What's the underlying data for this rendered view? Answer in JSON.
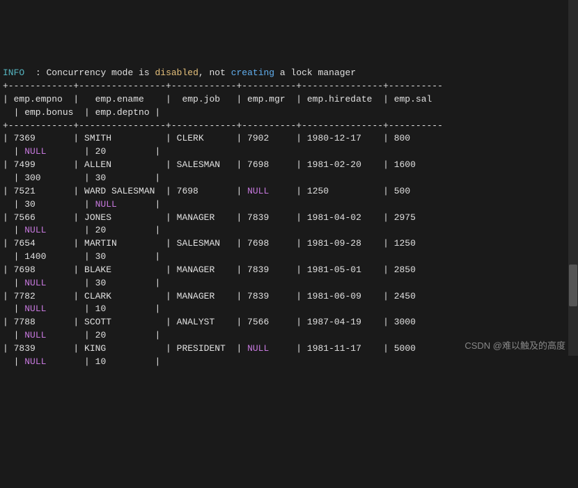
{
  "info_label": "INFO",
  "info_sep": "  : ",
  "info_msg_a": "Concurrency mode is ",
  "info_msg_b": "disabled",
  "info_msg_c": ", not ",
  "info_msg_d": "creating",
  "info_msg_e": " a lock manager",
  "divider_top": "+------------+----------------+------------+----------+---------------+----------",
  "header_line1": "| emp.empno  |   emp.ename    |  emp.job   | emp.mgr  | emp.hiredate  | emp.sal  ",
  "header_line2": "  | emp.bonus  | emp.deptno |",
  "divider_mid": "+------------+----------------+------------+----------+---------------+----------",
  "rows": [
    {
      "a": "| 7369       | SMITH          | CLERK      | 7902     | 1980-12-17    | 800      ",
      "b_pre": "  | ",
      "b_null": "NULL",
      "b_post": "       | 20         |"
    },
    {
      "a": "| 7499       | ALLEN          | SALESMAN   | 7698     | 1981-02-20    | 1600     ",
      "b_pre": "  | 300        | 30         |",
      "b_null": "",
      "b_post": ""
    },
    {
      "a_pre": "| 7521       | WARD SALESMAN  | 7698       | ",
      "a_null": "NULL",
      "a_post": "     | 1250          | 500      ",
      "b_pre": "  | 30         | ",
      "b_null": "NULL",
      "b_post": "       |"
    },
    {
      "a": "| 7566       | JONES          | MANAGER    | 7839     | 1981-04-02    | 2975     ",
      "b_pre": "  | ",
      "b_null": "NULL",
      "b_post": "       | 20         |"
    },
    {
      "a": "| 7654       | MARTIN         | SALESMAN   | 7698     | 1981-09-28    | 1250     ",
      "b_pre": "  | 1400       | 30         |",
      "b_null": "",
      "b_post": ""
    },
    {
      "a": "| 7698       | BLAKE          | MANAGER    | 7839     | 1981-05-01    | 2850     ",
      "b_pre": "  | ",
      "b_null": "NULL",
      "b_post": "       | 30         |"
    },
    {
      "a": "| 7782       | CLARK          | MANAGER    | 7839     | 1981-06-09    | 2450     ",
      "b_pre": "  | ",
      "b_null": "NULL",
      "b_post": "       | 10         |"
    },
    {
      "a": "| 7788       | SCOTT          | ANALYST    | 7566     | 1987-04-19    | 3000     ",
      "b_pre": "  | ",
      "b_null": "NULL",
      "b_post": "       | 20         |"
    },
    {
      "a_pre": "| 7839       | KING           | PRESIDENT  | ",
      "a_null": "NULL",
      "a_post": "     | 1981-11-17    | 5000     ",
      "b_pre": "  | ",
      "b_null": "NULL",
      "b_post": "       | 10         |"
    }
  ],
  "watermark": "CSDN @难以触及的高度",
  "chart_data": {
    "type": "table",
    "columns": [
      "emp.empno",
      "emp.ename",
      "emp.job",
      "emp.mgr",
      "emp.hiredate",
      "emp.sal",
      "emp.bonus",
      "emp.deptno"
    ],
    "rows": [
      [
        7369,
        "SMITH",
        "CLERK",
        7902,
        "1980-12-17",
        800,
        null,
        20
      ],
      [
        7499,
        "ALLEN",
        "SALESMAN",
        7698,
        "1981-02-20",
        1600,
        300,
        30
      ],
      [
        7521,
        "WARD SALESMAN",
        "7698",
        null,
        "1250",
        500,
        30,
        null
      ],
      [
        7566,
        "JONES",
        "MANAGER",
        7839,
        "1981-04-02",
        2975,
        null,
        20
      ],
      [
        7654,
        "MARTIN",
        "SALESMAN",
        7698,
        "1981-09-28",
        1250,
        1400,
        30
      ],
      [
        7698,
        "BLAKE",
        "MANAGER",
        7839,
        "1981-05-01",
        2850,
        null,
        30
      ],
      [
        7782,
        "CLARK",
        "MANAGER",
        7839,
        "1981-06-09",
        2450,
        null,
        10
      ],
      [
        7788,
        "SCOTT",
        "ANALYST",
        7566,
        "1987-04-19",
        3000,
        null,
        20
      ],
      [
        7839,
        "KING",
        "PRESIDENT",
        null,
        "1981-11-17",
        5000,
        null,
        10
      ]
    ]
  }
}
